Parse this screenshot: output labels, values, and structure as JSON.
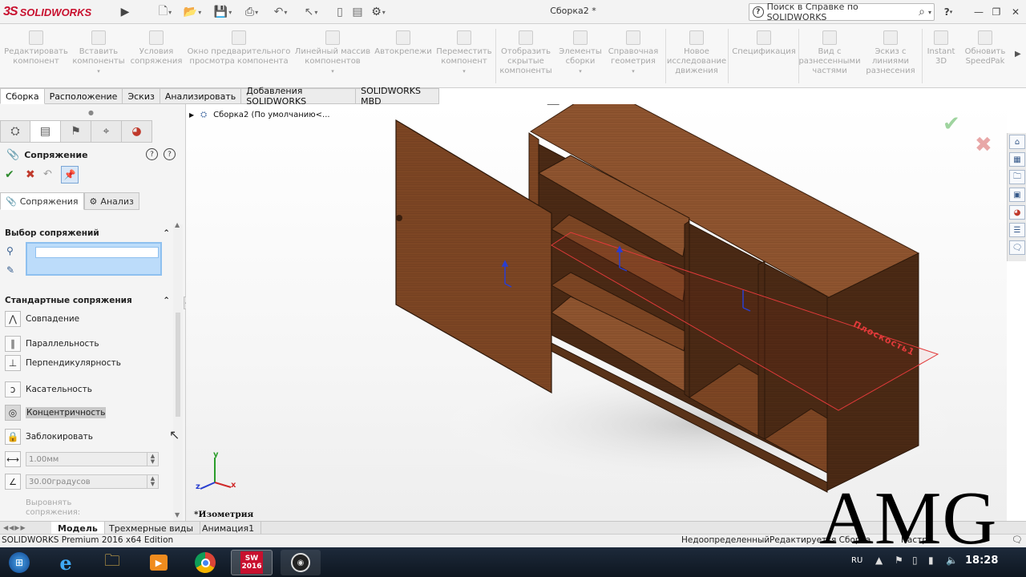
{
  "app": {
    "brand_ds": "3S",
    "brand_name": "SOLIDWORKS",
    "document_title": "Сборка2 *",
    "search_placeholder": "Поиск в Справке по SOLIDWORKS"
  },
  "commands": [
    {
      "label": "Редактировать компонент"
    },
    {
      "label": "Вставить компоненты"
    },
    {
      "label": "Условия сопряжения"
    },
    {
      "label": "Окно предварительного просмотра компонента"
    },
    {
      "label": "Линейный массив компонентов"
    },
    {
      "label": "Автокрепежи"
    },
    {
      "label": "Переместить компонент"
    },
    {
      "label": "Отобразить скрытые компоненты"
    },
    {
      "label": "Элементы сборки"
    },
    {
      "label": "Справочная геометрия"
    },
    {
      "label": "Новое исследование движения"
    },
    {
      "label": "Спецификация"
    },
    {
      "label": "Вид с разнесенными частями"
    },
    {
      "label": "Эскиз с линиями разнесения"
    },
    {
      "label": "Instant 3D"
    },
    {
      "label": "Обновить SpeedPak"
    }
  ],
  "tabs": [
    "Сборка",
    "Расположение",
    "Эскиз",
    "Анализировать",
    "Добавления SOLIDWORKS",
    "SOLIDWORKS MBD"
  ],
  "property_manager": {
    "title": "Сопряжение",
    "subtabs": [
      "Сопряжения",
      "Анализ"
    ],
    "selection_header": "Выбор сопряжений",
    "standard_header": "Стандартные сопряжения",
    "mates": [
      {
        "label": "Совпадение"
      },
      {
        "label": "Параллельность"
      },
      {
        "label": "Перпендикулярность"
      },
      {
        "label": "Касательность"
      },
      {
        "label": "Концентричность"
      },
      {
        "label": "Заблокировать"
      }
    ],
    "distance_value": "1.00мм",
    "angle_value": "30.00градусов",
    "align_label": "Выровнять сопряжения:"
  },
  "viewport": {
    "tree_root": "Сборка2  (По умолчанию<...",
    "view_name": "*Изометрия",
    "plane_label": "Плоскость1",
    "axis_x": "x",
    "axis_y": "y",
    "axis_z": "z"
  },
  "model_tabs": [
    "Модель",
    "Трехмерные виды",
    "Анимация1"
  ],
  "status": {
    "product": "SOLIDWORKS Premium 2016 x64 Edition",
    "state": "Недоопределенный",
    "mode": "Редактируется Сборка",
    "settings": "Настр"
  },
  "taskbar": {
    "lang": "RU",
    "time": "18:28",
    "sw_badge": "2016"
  },
  "watermark": "AMG",
  "colors": {
    "brand_red": "#c8102e",
    "wood_light": "#8a4f2a",
    "wood_dark": "#4a2a15",
    "plane_red": "#e23a3a",
    "selection_blue": "#bcdcfa"
  }
}
